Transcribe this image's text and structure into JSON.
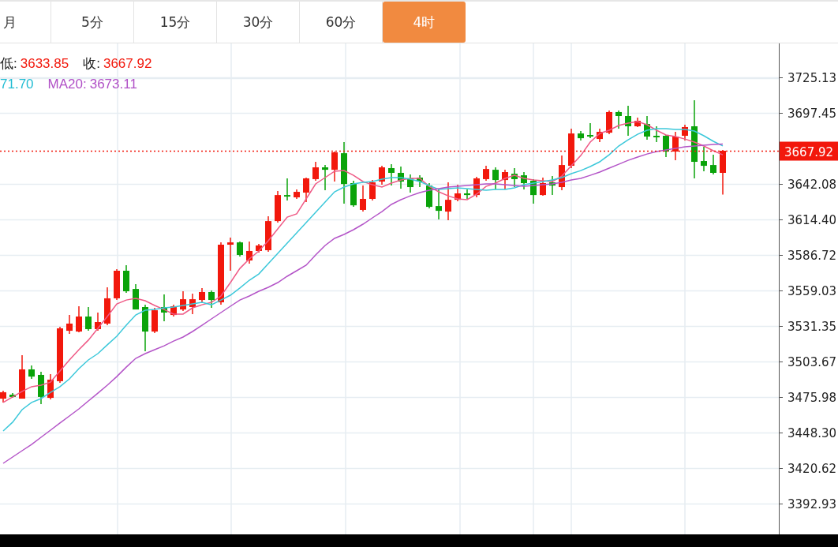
{
  "tabs": [
    {
      "label": "月",
      "selected": false
    },
    {
      "label": "5分",
      "selected": false
    },
    {
      "label": "15分",
      "selected": false
    },
    {
      "label": "30分",
      "selected": false
    },
    {
      "label": "60分",
      "selected": false
    },
    {
      "label": "4时",
      "selected": true
    }
  ],
  "legend": [
    [
      {
        "label": "低:",
        "value": "3633.85",
        "color": "#f2180c"
      },
      {
        "label": "收:",
        "value": "3667.92",
        "color": "#f2180c"
      }
    ],
    [
      {
        "value": "71.70",
        "color": "#22bcd3"
      },
      {
        "label": "MA20:",
        "value": "3673.11",
        "color": "#b04fc6"
      }
    ]
  ],
  "chart_data": {
    "type": "candlestick",
    "grid": true,
    "ylim": [
      3368.9,
      3751.6
    ],
    "yticks": [
      {
        "value": 3725.13,
        "label": "3725.13"
      },
      {
        "value": 3697.45,
        "label": "3697.45"
      },
      {
        "value": 3642.08,
        "label": "3642.08"
      },
      {
        "value": 3614.4,
        "label": "3614.40"
      },
      {
        "value": 3586.72,
        "label": "3586.72"
      },
      {
        "value": 3559.03,
        "label": "3559.03"
      },
      {
        "value": 3531.35,
        "label": "3531.35"
      },
      {
        "value": 3503.67,
        "label": "3503.67"
      },
      {
        "value": 3475.98,
        "label": "3475.98"
      },
      {
        "value": 3448.3,
        "label": "3448.30"
      },
      {
        "value": 3420.62,
        "label": "3420.62"
      },
      {
        "value": 3392.93,
        "label": "3392.93"
      }
    ],
    "ref_lines": [
      {
        "axis": "y",
        "value": 3667.92,
        "label": "3667.92",
        "color": "#f2180c"
      }
    ],
    "series": [
      {
        "type": "line",
        "color": "#ef5a86",
        "values": [
          3471.7,
          3476.0,
          3480.3,
          3484.0,
          3485.2,
          3487.6,
          3496.3,
          3504.9,
          3512.9,
          3520.3,
          3529.5,
          3538.7,
          3548.5,
          3551.6,
          3552.9,
          3551.0,
          3547.3,
          3544.2,
          3540.6,
          3540.6,
          3545.5,
          3547.9,
          3549.8,
          3554.7,
          3565.2,
          3576.2,
          3583.6,
          3589.8,
          3597.8,
          3607.0,
          3616.2,
          3618.7,
          3630.4,
          3642.1,
          3647.0,
          3651.9,
          3652.5,
          3648.8,
          3643.9,
          3641.4,
          3639.6,
          3642.7,
          3645.1,
          3646.4,
          3646.4,
          3640.2,
          3635.9,
          3632.8,
          3630.4,
          3629.8,
          3634.1,
          3640.2,
          3642.7,
          3646.4,
          3648.8,
          3646.4,
          3645.1,
          3644.5,
          3643.9,
          3648.2,
          3656.2,
          3664.2,
          3674.7,
          3681.4,
          3683.9,
          3687.6,
          3689.4,
          3690.7,
          3688.2,
          3683.9,
          3680.2,
          3679.0,
          3677.1,
          3674.7,
          3671.6,
          3667.9,
          3664.8
        ]
      },
      {
        "type": "line",
        "color": "#3cc8da",
        "values": [
          3449.5,
          3456.3,
          3466.1,
          3471.7,
          3474.7,
          3479.6,
          3484.0,
          3490.1,
          3498.1,
          3504.9,
          3509.8,
          3516.6,
          3523.3,
          3531.9,
          3539.9,
          3543.6,
          3544.2,
          3545.5,
          3546.1,
          3547.3,
          3548.5,
          3549.8,
          3547.9,
          3551.6,
          3555.3,
          3560.9,
          3567.0,
          3571.9,
          3579.9,
          3587.9,
          3595.9,
          3603.9,
          3611.9,
          3619.9,
          3627.9,
          3635.9,
          3639.6,
          3642.1,
          3643.3,
          3643.9,
          3645.7,
          3647.0,
          3647.0,
          3645.7,
          3643.9,
          3640.8,
          3637.8,
          3638.4,
          3639.0,
          3638.4,
          3637.8,
          3637.1,
          3637.8,
          3637.8,
          3639.0,
          3641.4,
          3642.7,
          3643.9,
          3645.1,
          3647.0,
          3650.1,
          3652.5,
          3655.6,
          3659.3,
          3664.8,
          3671.6,
          3676.5,
          3680.8,
          3683.9,
          3685.1,
          3685.1,
          3684.5,
          3684.5,
          3683.3,
          3679.6,
          3675.3,
          3671.7
        ]
      },
      {
        "type": "line",
        "color": "#b455c8",
        "values": [
          3424.3,
          3429.2,
          3434.1,
          3439.0,
          3444.6,
          3450.1,
          3455.7,
          3461.2,
          3466.7,
          3472.9,
          3479.0,
          3485.2,
          3491.9,
          3499.3,
          3506.1,
          3509.8,
          3512.9,
          3515.9,
          3519.6,
          3522.7,
          3527.0,
          3531.9,
          3536.9,
          3541.8,
          3546.7,
          3551.6,
          3554.7,
          3558.4,
          3561.5,
          3565.2,
          3570.1,
          3574.4,
          3578.7,
          3586.7,
          3594.1,
          3599.6,
          3602.7,
          3606.4,
          3610.7,
          3615.6,
          3620.5,
          3626.1,
          3629.8,
          3632.8,
          3635.3,
          3637.1,
          3638.4,
          3639.6,
          3640.2,
          3640.8,
          3641.4,
          3642.1,
          3642.1,
          3641.4,
          3640.8,
          3640.2,
          3640.8,
          3641.4,
          3642.1,
          3643.3,
          3645.1,
          3646.4,
          3648.8,
          3651.3,
          3654.4,
          3657.4,
          3660.5,
          3663.0,
          3665.4,
          3667.3,
          3668.5,
          3669.7,
          3671.0,
          3671.6,
          3672.2,
          3672.8,
          3673.1
        ]
      }
    ],
    "ohlc": [
      [
        3474.7,
        3480.9,
        3471.6,
        3479.7
      ],
      [
        3477.8,
        3479.0,
        3475.3,
        3476.0
      ],
      [
        3474.7,
        3508.6,
        3474.7,
        3497.5
      ],
      [
        3497.5,
        3500.6,
        3490.1,
        3491.9
      ],
      [
        3493.2,
        3495.6,
        3470.4,
        3476.0
      ],
      [
        3475.3,
        3493.8,
        3474.1,
        3489.5
      ],
      [
        3488.3,
        3530.7,
        3487.1,
        3529.5
      ],
      [
        3527.6,
        3539.9,
        3525.2,
        3533.2
      ],
      [
        3527.0,
        3546.7,
        3526.4,
        3538.7
      ],
      [
        3538.7,
        3546.1,
        3527.6,
        3528.9
      ],
      [
        3528.9,
        3541.8,
        3527.6,
        3534.4
      ],
      [
        3533.2,
        3561.5,
        3531.9,
        3552.9
      ],
      [
        3552.9,
        3575.6,
        3551.6,
        3574.4
      ],
      [
        3574.4,
        3578.7,
        3557.2,
        3558.4
      ],
      [
        3560.2,
        3563.9,
        3544.2,
        3544.2
      ],
      [
        3546.1,
        3547.9,
        3511.6,
        3527.0
      ],
      [
        3527.0,
        3545.5,
        3525.8,
        3543.6
      ],
      [
        3546.1,
        3555.9,
        3535.0,
        3541.8
      ],
      [
        3539.9,
        3547.9,
        3538.7,
        3546.7
      ],
      [
        3544.2,
        3558.4,
        3543.0,
        3552.2
      ],
      [
        3546.1,
        3556.6,
        3540.5,
        3552.2
      ],
      [
        3551.6,
        3560.8,
        3549.8,
        3557.8
      ],
      [
        3557.8,
        3559.0,
        3545.5,
        3551.6
      ],
      [
        3549.8,
        3596.5,
        3547.9,
        3594.7
      ],
      [
        3594.7,
        3600.2,
        3574.4,
        3596.5
      ],
      [
        3596.5,
        3597.2,
        3585.5,
        3586.7
      ],
      [
        3582.4,
        3597.2,
        3579.9,
        3589.8
      ],
      [
        3589.8,
        3595.3,
        3588.5,
        3594.1
      ],
      [
        3590.4,
        3616.8,
        3589.2,
        3613.1
      ],
      [
        3613.1,
        3636.5,
        3611.9,
        3633.4
      ],
      [
        3633.4,
        3646.4,
        3629.1,
        3632.2
      ],
      [
        3631.6,
        3637.7,
        3630.4,
        3635.9
      ],
      [
        3635.3,
        3647.0,
        3627.9,
        3646.4
      ],
      [
        3645.8,
        3659.3,
        3644.5,
        3655.0
      ],
      [
        3655.0,
        3656.8,
        3637.1,
        3653.1
      ],
      [
        3653.1,
        3667.3,
        3643.9,
        3666.7
      ],
      [
        3666.0,
        3674.7,
        3626.7,
        3642.0
      ],
      [
        3642.7,
        3644.5,
        3624.2,
        3625.4
      ],
      [
        3621.8,
        3640.8,
        3620.5,
        3630.4
      ],
      [
        3630.4,
        3645.1,
        3629.1,
        3643.3
      ],
      [
        3643.9,
        3656.2,
        3641.4,
        3655.0
      ],
      [
        3654.4,
        3657.4,
        3640.8,
        3650.7
      ],
      [
        3650.7,
        3655.6,
        3638.4,
        3643.9
      ],
      [
        3646.4,
        3649.4,
        3635.3,
        3639.6
      ],
      [
        3647.0,
        3648.8,
        3639.6,
        3643.9
      ],
      [
        3640.8,
        3642.7,
        3623.0,
        3624.2
      ],
      [
        3624.8,
        3637.7,
        3614.4,
        3621.1
      ],
      [
        3620.5,
        3643.3,
        3613.8,
        3629.7
      ],
      [
        3629.7,
        3641.4,
        3628.5,
        3634.7
      ],
      [
        3634.7,
        3637.7,
        3630.4,
        3633.4
      ],
      [
        3633.4,
        3647.6,
        3631.6,
        3646.4
      ],
      [
        3645.8,
        3656.2,
        3644.5,
        3653.7
      ],
      [
        3653.1,
        3655.0,
        3637.7,
        3645.1
      ],
      [
        3645.1,
        3653.1,
        3637.7,
        3651.3
      ],
      [
        3650.0,
        3654.4,
        3639.6,
        3645.8
      ],
      [
        3648.8,
        3651.3,
        3637.8,
        3642.7
      ],
      [
        3644.5,
        3645.8,
        3626.7,
        3633.4
      ],
      [
        3633.4,
        3647.0,
        3632.8,
        3642.7
      ],
      [
        3643.3,
        3648.2,
        3633.4,
        3640.8
      ],
      [
        3639.6,
        3664.2,
        3637.1,
        3656.8
      ],
      [
        3656.2,
        3685.1,
        3654.4,
        3681.4
      ],
      [
        3681.4,
        3683.3,
        3675.9,
        3677.7
      ],
      [
        3680.2,
        3689.4,
        3677.7,
        3679.0
      ],
      [
        3677.1,
        3685.1,
        3674.7,
        3682.7
      ],
      [
        3682.0,
        3699.3,
        3680.8,
        3698.1
      ],
      [
        3698.1,
        3699.3,
        3685.1,
        3695.0
      ],
      [
        3695.0,
        3703.0,
        3679.6,
        3687.0
      ],
      [
        3687.0,
        3693.7,
        3686.4,
        3691.3
      ],
      [
        3688.8,
        3695.0,
        3676.5,
        3679.0
      ],
      [
        3679.6,
        3687.0,
        3674.7,
        3678.4
      ],
      [
        3679.6,
        3680.2,
        3663.0,
        3667.3
      ],
      [
        3667.3,
        3682.7,
        3660.5,
        3679.0
      ],
      [
        3679.6,
        3688.2,
        3675.9,
        3686.4
      ],
      [
        3687.0,
        3707.3,
        3646.4,
        3659.3
      ],
      [
        3659.9,
        3671.0,
        3651.9,
        3656.2
      ],
      [
        3656.8,
        3664.8,
        3649.4,
        3650.7
      ],
      [
        3650.7,
        3668.5,
        3633.85,
        3667.92
      ]
    ]
  }
}
